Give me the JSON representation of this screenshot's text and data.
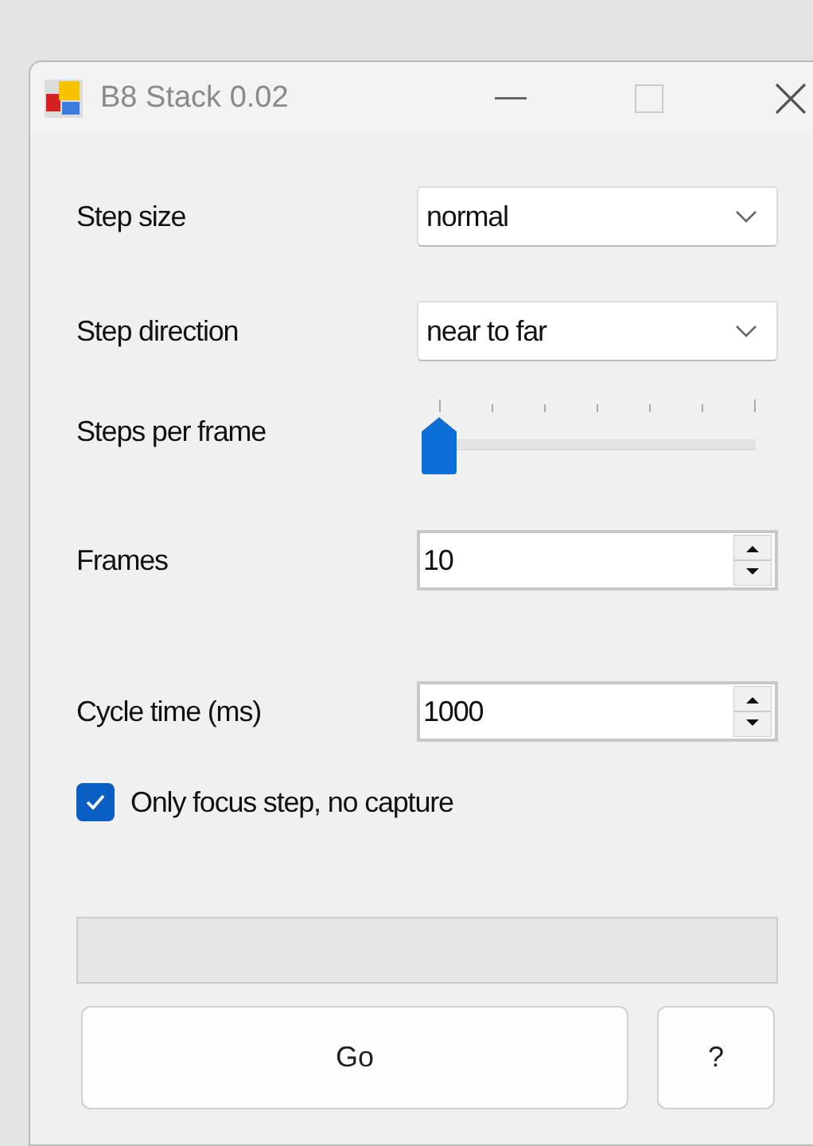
{
  "window": {
    "title": "B8 Stack 0.02"
  },
  "fields": [
    {
      "kind": "dropdown",
      "label": "Step size",
      "value": "normal"
    },
    {
      "kind": "dropdown",
      "label": "Step direction",
      "value": "near to far"
    },
    {
      "kind": "slider",
      "label": "Steps per frame",
      "level": 0
    },
    {
      "kind": "spinner",
      "label": "Frames",
      "value": "10"
    },
    {
      "kind": "spinner",
      "label": "Cycle time (ms)",
      "value": "1000"
    },
    {
      "kind": "checkbox",
      "label": "Only focus step, no capture",
      "checked": true
    }
  ],
  "progress": {
    "level": 0
  },
  "buttons": [
    {
      "label": "Go"
    },
    {
      "label": "?"
    }
  ]
}
